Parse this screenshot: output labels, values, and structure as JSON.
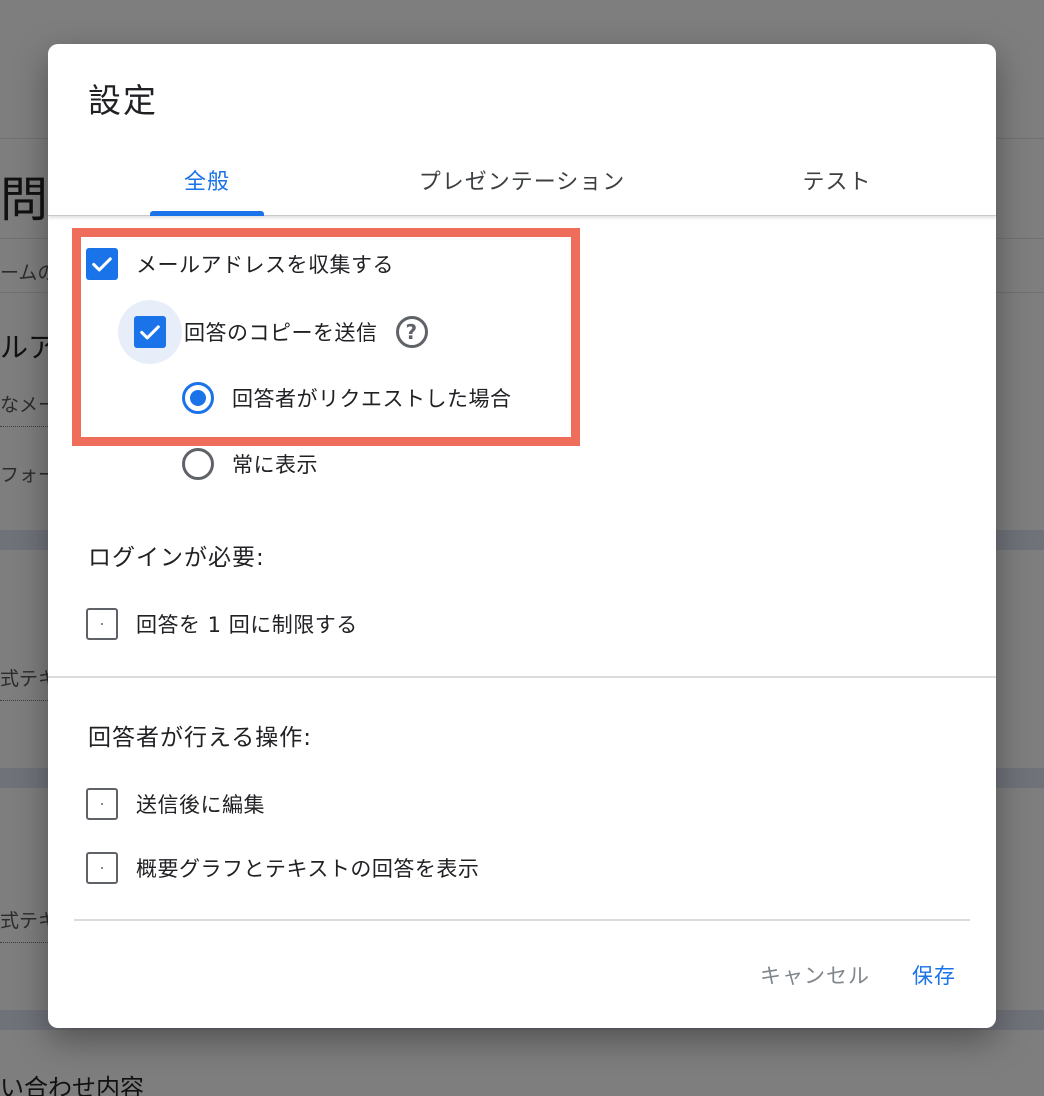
{
  "background": {
    "heading": "問",
    "lines": [
      "ームの",
      "ルア",
      "なメー",
      "フォー",
      "式テキ",
      "式テキ"
    ],
    "bottom_text": "い合わせ内容"
  },
  "dialog": {
    "title": "設定",
    "tabs": [
      {
        "label": "全般",
        "active": true
      },
      {
        "label": "プレゼンテーション",
        "active": false
      },
      {
        "label": "テスト",
        "active": false
      }
    ],
    "collect_email": {
      "label": "メールアドレスを収集する",
      "checked": true
    },
    "send_copy": {
      "label": "回答のコピーを送信",
      "checked": true
    },
    "copy_options": [
      {
        "label": "回答者がリクエストした場合",
        "selected": true
      },
      {
        "label": "常に表示",
        "selected": false
      }
    ],
    "login_section": {
      "title": "ログインが必要:",
      "limit_one": {
        "label": "回答を 1 回に制限する",
        "checked": false
      }
    },
    "respondent_section": {
      "title": "回答者が行える操作:",
      "edit_after_submit": {
        "label": "送信後に編集",
        "checked": false
      },
      "view_summary": {
        "label": "概要グラフとテキストの回答を表示",
        "checked": false
      }
    },
    "buttons": {
      "cancel": "キャンセル",
      "save": "保存"
    }
  },
  "colors": {
    "accent": "#1a73e8",
    "highlight": "#ef6e5b"
  }
}
